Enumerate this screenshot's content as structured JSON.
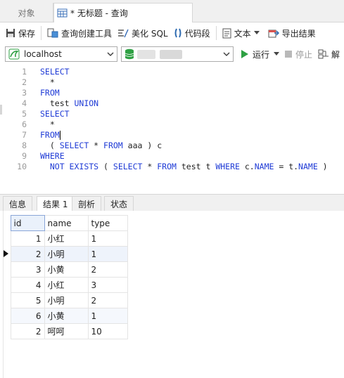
{
  "tabs": {
    "objects_label": "对象",
    "query_label": "* 无标题 - 查询"
  },
  "toolbar": {
    "save": "保存",
    "query_builder": "查询创建工具",
    "beautify": "美化 SQL",
    "snippet": "代码段",
    "text": "文本",
    "export": "导出结果"
  },
  "connection": {
    "host": "localhost",
    "run": "运行",
    "stop": "停止",
    "explain": "解"
  },
  "editor": {
    "line_numbers": [
      "1",
      "2",
      "3",
      "4",
      "5",
      "6",
      "7",
      "8",
      "9",
      "10"
    ],
    "lines": [
      [
        {
          "t": "SELECT",
          "k": true
        }
      ],
      [
        {
          "t": "  *",
          "k": false
        }
      ],
      [
        {
          "t": "FROM",
          "k": true
        }
      ],
      [
        {
          "t": "  test ",
          "k": false
        },
        {
          "t": "UNION",
          "k": true
        }
      ],
      [
        {
          "t": "SELECT",
          "k": true
        }
      ],
      [
        {
          "t": "  *",
          "k": false
        }
      ],
      [
        {
          "t": "FROM",
          "k": true
        }
      ],
      [
        {
          "t": "  ( ",
          "k": false
        },
        {
          "t": "SELECT",
          "k": true
        },
        {
          "t": " * ",
          "k": false
        },
        {
          "t": "FROM",
          "k": true
        },
        {
          "t": " aaa ) c",
          "k": false
        }
      ],
      [
        {
          "t": "WHERE",
          "k": true
        }
      ],
      [
        {
          "t": "  ",
          "k": false
        },
        {
          "t": "NOT EXISTS",
          "k": true
        },
        {
          "t": " ( ",
          "k": false
        },
        {
          "t": "SELECT",
          "k": true
        },
        {
          "t": " * ",
          "k": false
        },
        {
          "t": "FROM",
          "k": true
        },
        {
          "t": " test t ",
          "k": false
        },
        {
          "t": "WHERE",
          "k": true
        },
        {
          "t": " c.",
          "k": false
        },
        {
          "t": "NAME",
          "k": true
        },
        {
          "t": " = t.",
          "k": false
        },
        {
          "t": "NAME",
          "k": true
        },
        {
          "t": " )",
          "k": false
        }
      ]
    ]
  },
  "result_tabs": {
    "info": "信息",
    "result1": "结果 1",
    "profile": "剖析",
    "status": "状态"
  },
  "grid": {
    "columns": [
      "id",
      "name",
      "type"
    ],
    "rows": [
      [
        "1",
        "小红",
        "1"
      ],
      [
        "2",
        "小明",
        "1"
      ],
      [
        "3",
        "小黄",
        "2"
      ],
      [
        "4",
        "小红",
        "3"
      ],
      [
        "5",
        "小明",
        "2"
      ],
      [
        "6",
        "小黄",
        "1"
      ],
      [
        "2",
        "呵呵",
        "10"
      ]
    ],
    "selected_row": 1,
    "highlighted_row": 5
  },
  "colors": {
    "keyword": "#1f3bd6",
    "run_green": "#2ea043",
    "selection": "#eef3fb"
  }
}
